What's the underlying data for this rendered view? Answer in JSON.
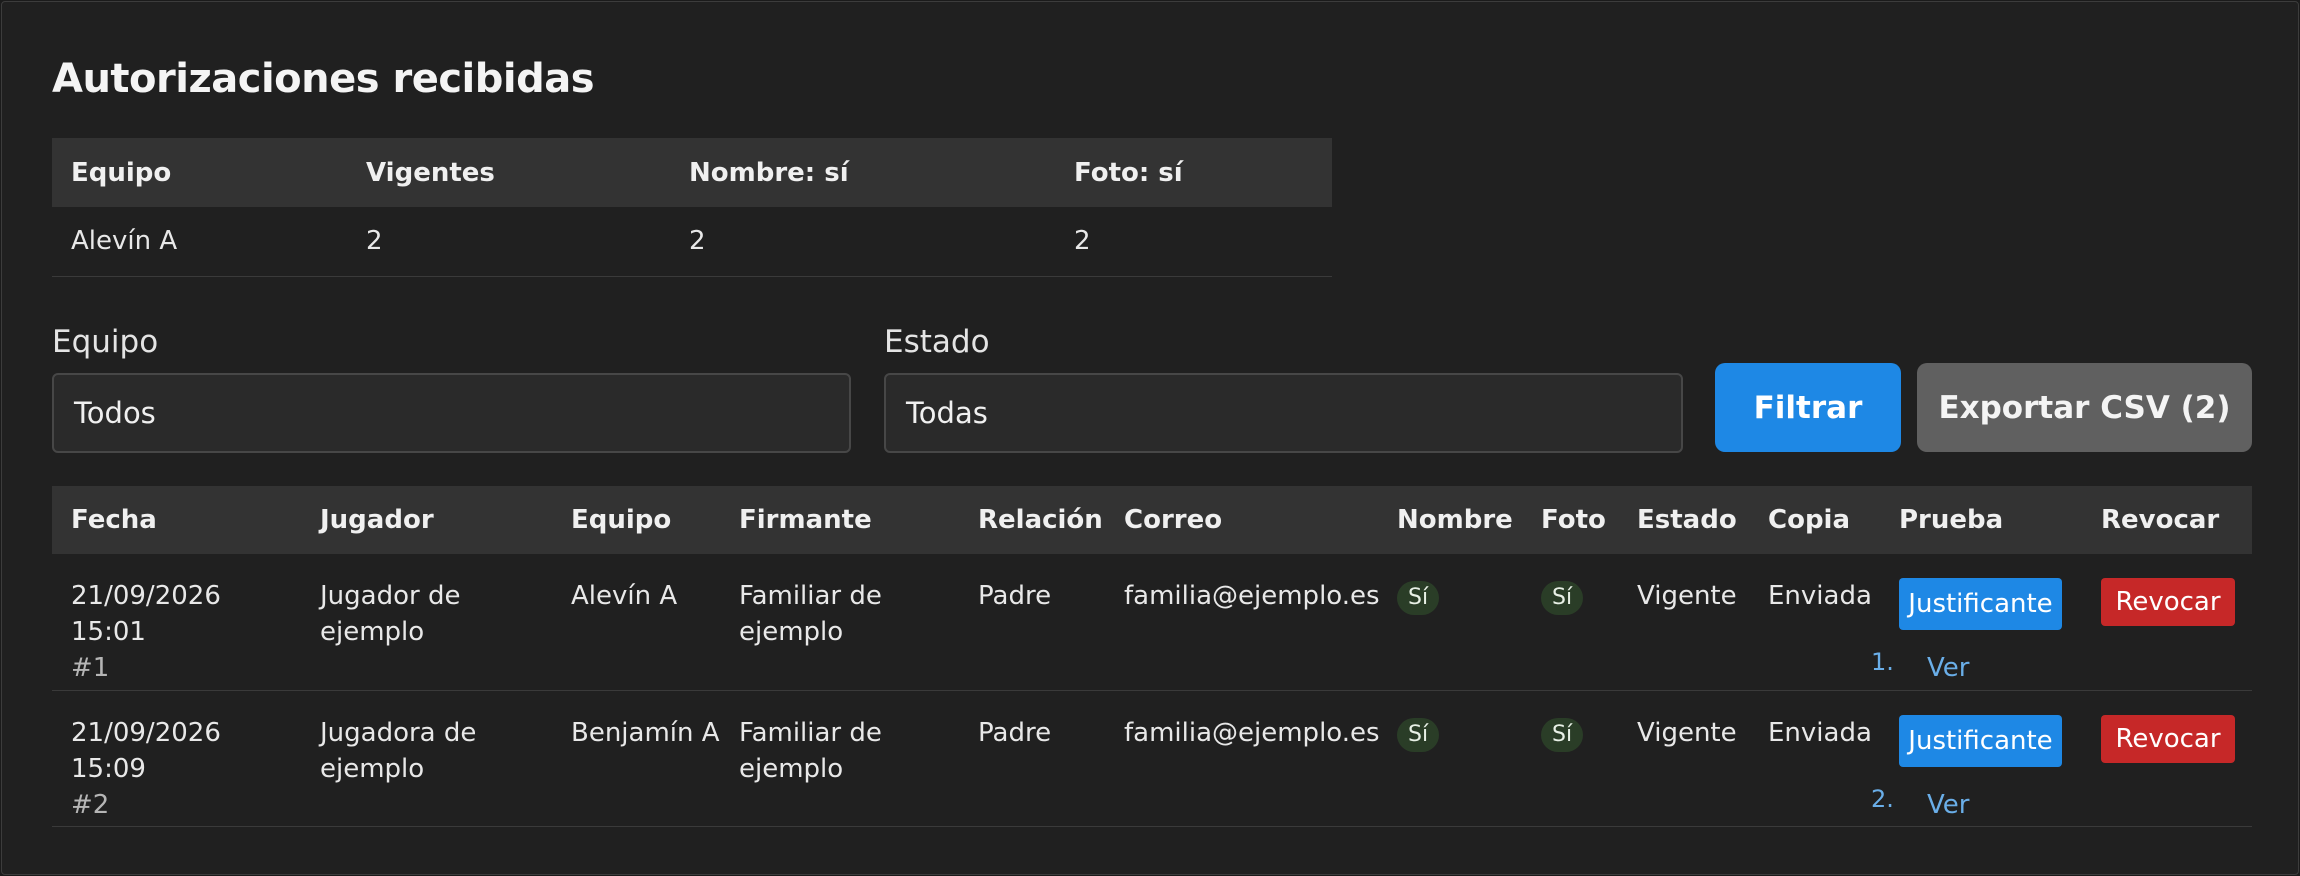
{
  "title": "Autorizaciones recibidas",
  "summary": {
    "headers": [
      "Equipo",
      "Vigentes",
      "Nombre: sí",
      "Foto: sí"
    ],
    "rows": [
      [
        "Alevín A",
        "2",
        "2",
        "2"
      ]
    ]
  },
  "filters": {
    "equipo_label": "Equipo",
    "equipo_value": "Todos",
    "estado_label": "Estado",
    "estado_value": "Todas",
    "filter_button": "Filtrar",
    "export_button": "Exportar CSV (2)"
  },
  "table": {
    "headers": [
      "Fecha",
      "Jugador",
      "Equipo",
      "Firmante",
      "Relación",
      "Correo",
      "Nombre",
      "Foto",
      "Estado",
      "Copia",
      "Prueba",
      "Revocar"
    ],
    "rows": [
      {
        "fecha": "21/09/2026 15:01",
        "id": "#1",
        "jugador": "Jugador de ejemplo",
        "equipo": "Alevín A",
        "firmante": "Familiar de ejemplo",
        "relacion": "Padre",
        "correo": "familia@ejemplo.es",
        "nombre": "Sí",
        "foto": "Sí",
        "estado": "Vigente",
        "copia": "Enviada",
        "prueba_button": "Justificante",
        "proof_number": "1.",
        "proof_link": "Ver",
        "revocar_button": "Revocar"
      },
      {
        "fecha": "21/09/2026 15:09",
        "id": "#2",
        "jugador": "Jugadora de ejemplo",
        "equipo": "Benjamín A",
        "firmante": "Familiar de ejemplo",
        "relacion": "Padre",
        "correo": "familia@ejemplo.es",
        "nombre": "Sí",
        "foto": "Sí",
        "estado": "Vigente",
        "copia": "Enviada",
        "prueba_button": "Justificante",
        "proof_number": "2.",
        "proof_link": "Ver",
        "revocar_button": "Revocar"
      }
    ]
  },
  "colors": {
    "background": "#202020",
    "header_bg": "#333333",
    "primary": "#1e88e5",
    "danger": "#c62828",
    "badge_bg": "#2a3d27",
    "link": "#6aaee8"
  }
}
